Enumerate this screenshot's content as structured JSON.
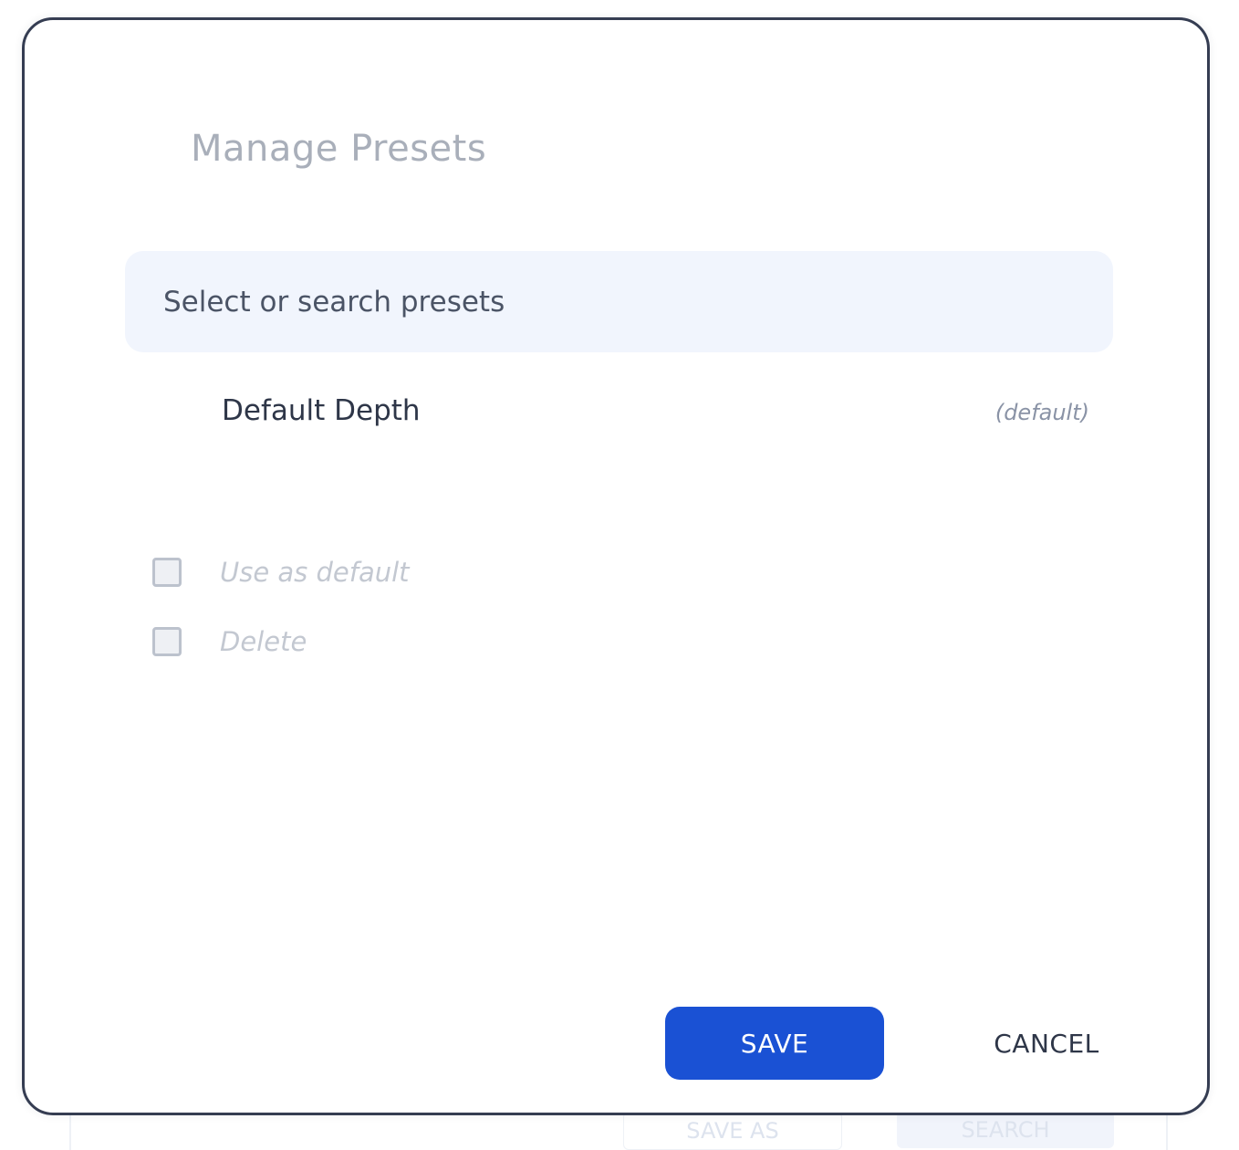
{
  "background": {
    "left_button_label": "SAVE AS",
    "right_button_label": "SEARCH"
  },
  "modal": {
    "title": "Manage Presets",
    "search": {
      "placeholder": "Select or search presets",
      "value": ""
    },
    "presets": [
      {
        "name": "Default Depth",
        "tag": "(default)"
      }
    ],
    "options": [
      {
        "label": "Use as default",
        "checked": false,
        "disabled": true
      },
      {
        "label": "Delete",
        "checked": false,
        "disabled": true
      }
    ],
    "actions": {
      "save_label": "SAVE",
      "cancel_label": "CANCEL"
    }
  },
  "colors": {
    "primary": "#1a51d4",
    "modal_border": "#353d52",
    "search_bg": "#f1f5fd"
  }
}
